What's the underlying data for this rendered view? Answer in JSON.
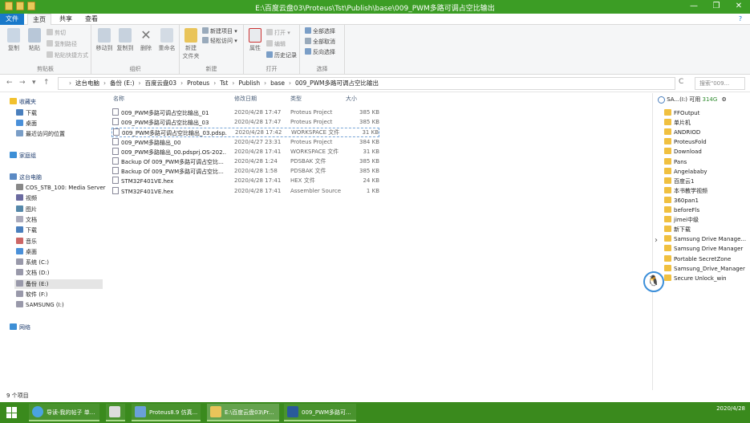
{
  "window": {
    "title": "E:\\百度云盘03\\Proteus\\Tst\\Publish\\base\\009_PWM多路可调占空比输出",
    "controls": [
      "—",
      "❐",
      "✕"
    ]
  },
  "tabs": {
    "file": "文件",
    "home": "主页",
    "share": "共享",
    "view": "查看"
  },
  "ribbon": {
    "clipboard": {
      "label": "剪贴板",
      "copy": "复制",
      "paste": "粘贴",
      "cut": "剪切",
      "copy_path": "复制路径",
      "paste_shortcut": "粘贴快捷方式"
    },
    "organize": {
      "label": "组织",
      "move_to": "移动到",
      "copy_to": "复制到",
      "delete": "删除",
      "rename": "重命名"
    },
    "new": {
      "label": "新建",
      "new_folder": "新建\n文件夹",
      "new_item": "新建项目 ▾",
      "easy_access": "轻松访问 ▾"
    },
    "open": {
      "label": "打开",
      "properties": "属性",
      "open": "打开 ▾",
      "edit": "编辑",
      "history": "历史记录"
    },
    "select": {
      "label": "选择",
      "select_all": "全部选择",
      "select_none": "全部取消",
      "invert": "反向选择"
    }
  },
  "address": {
    "crumbs": [
      "这台电脑",
      "备份 (E:)",
      "百度云盘03",
      "Proteus",
      "Tst",
      "Publish",
      "base",
      "009_PWM多路可调占空比输出"
    ],
    "search_placeholder": "搜索\"009...",
    "refresh": "C"
  },
  "navpane": {
    "favorites": "收藏夹",
    "fav_items": [
      "下载",
      "桌面",
      "最近访问的位置"
    ],
    "homegroup": "家庭组",
    "thispc": "这台电脑",
    "pc_items": [
      "COS_STB_100: Media Server",
      "视频",
      "图片",
      "文档",
      "下载",
      "音乐",
      "桌面",
      "系统 (C:)",
      "文档 (D:)",
      "备份 (E:)",
      "软件 (F:)",
      "SAMSUNG (I:)"
    ],
    "network": "网络"
  },
  "filelist": {
    "headers": {
      "name": "名称",
      "date": "修改日期",
      "type": "类型",
      "size": "大小"
    },
    "files": [
      {
        "name": "009_PWM多路可调占空比输出_01",
        "date": "2020/4/28 17:47",
        "type": "Proteus Project",
        "size": "385 KB"
      },
      {
        "name": "009_PWM多路可调占空比输出_03",
        "date": "2020/4/28 17:47",
        "type": "Proteus Project",
        "size": "385 KB"
      },
      {
        "name": "009_PWM多路可调占空比输出_03.pdsp...",
        "date": "2020/4/28 17:42",
        "type": "WORKSPACE 文件",
        "size": "31 KB"
      },
      {
        "name": "009_PWM多路输出_00",
        "date": "2020/4/27 23:31",
        "type": "Proteus Project",
        "size": "384 KB"
      },
      {
        "name": "009_PWM多路输出_00.pdsprj.OS-202...",
        "date": "2020/4/28 17:41",
        "type": "WORKSPACE 文件",
        "size": "31 KB"
      },
      {
        "name": "Backup Of 009_PWM多路可调占空比...",
        "date": "2020/4/28 1:24",
        "type": "PDSBAK 文件",
        "size": "385 KB"
      },
      {
        "name": "Backup Of 009_PWM多路可调占空比...",
        "date": "2020/4/28 1:58",
        "type": "PDSBAK 文件",
        "size": "385 KB"
      },
      {
        "name": "STM32F401VE.hex",
        "date": "2020/4/28 17:41",
        "type": "HEX 文件",
        "size": "24 KB"
      },
      {
        "name": "STM32F401VE.hex",
        "date": "2020/4/28 17:41",
        "type": "Assembler Source",
        "size": "1 KB"
      }
    ]
  },
  "rightpanel": {
    "drive": "SA...(I:) 可用",
    "free": "314G",
    "items": [
      "FFOutput",
      "单片机",
      "ANDRIOD",
      "ProteusFold",
      "Download",
      "Pans",
      "Angelababy",
      "百度云1",
      "本书教学视频",
      "360pan1",
      "beforeFls",
      "jimei中级",
      "新下载",
      "Samsung Drive Manage...",
      "Samsung Drive Manager",
      "Portable SecretZone",
      "Samsung_Drive_Manager",
      "Secure Unlock_win"
    ]
  },
  "status": {
    "count": "9 个项目"
  },
  "taskbar": {
    "items": [
      "导读-我的帖子 单...",
      "Proteus8.9 仿真...",
      "E:\\百度云盘03\\Pr...",
      "009_PWM多路可..."
    ],
    "date": "2020/4/28"
  },
  "colors": {
    "accent": "#3c9d25",
    "taskbar": "#3a8a1d",
    "file_tab": "#1979ca"
  }
}
